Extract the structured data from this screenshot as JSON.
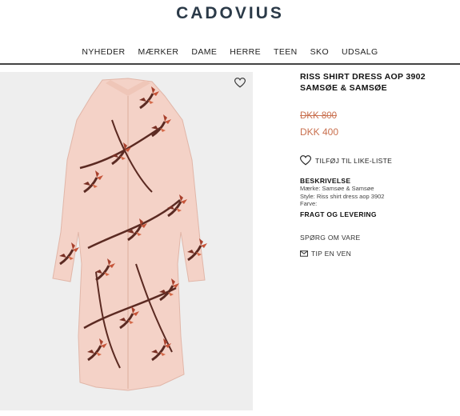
{
  "brand": {
    "logo_text": "CADOVIUS"
  },
  "nav": {
    "items": [
      {
        "label": "NYHEDER"
      },
      {
        "label": "MÆRKER"
      },
      {
        "label": "DAME"
      },
      {
        "label": "HERRE"
      },
      {
        "label": "TEEN"
      },
      {
        "label": "SKO"
      },
      {
        "label": "UDSALG"
      }
    ]
  },
  "product": {
    "title": "RISS SHIRT DRESS AOP 3902 SAMSØE & SAMSØE",
    "price_old": "DKK 800",
    "price_new": "DKK 400",
    "price_color": "#c9704f",
    "wishlist_label": "TILFØJ TIL LIKE-LISTE",
    "description_heading": "BESKRIVELSE",
    "description_lines": [
      "Mærke: Samsøe & Samsøe",
      "Style: Riss shirt dress aop 3902",
      "Farve:"
    ],
    "shipping_heading": "FRAGT OG LEVERING",
    "ask_label": "SPØRG OM VARE",
    "tip_label": "TIP EN VEN",
    "image": {
      "icon": "heart-icon",
      "background": "#eeeeee",
      "dress_color": "#f4d2c7"
    }
  }
}
